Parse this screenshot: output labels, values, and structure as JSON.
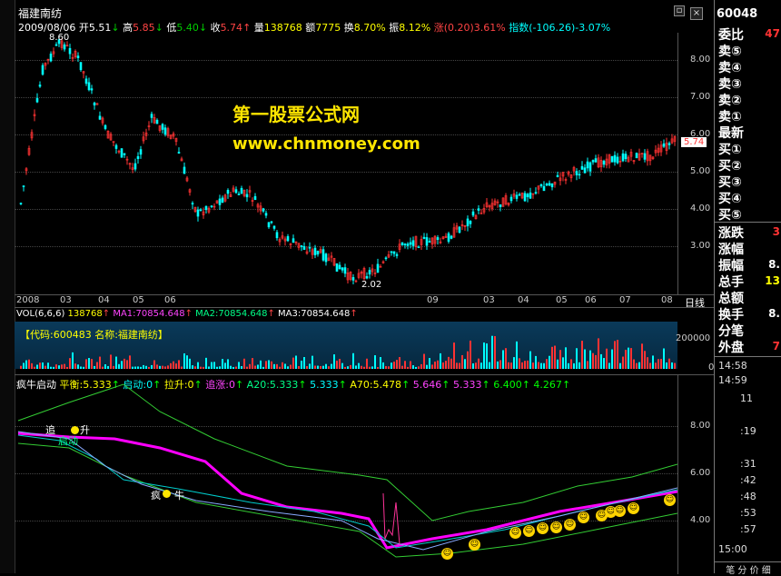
{
  "window": {
    "title": "福建南纺",
    "stock_code_partial": "60048"
  },
  "quote_line": {
    "date": "2009/08/06",
    "open_label": "开",
    "open": "5.51",
    "high_label": "高",
    "high": "5.85",
    "low_label": "低",
    "low": "5.40",
    "close_label": "收",
    "close": "5.74",
    "volume_label": "量",
    "volume": "138768",
    "amount_label": "额",
    "amount": "7775",
    "turnover_label": "换",
    "turnover": "8.70%",
    "amplitude_label": "振",
    "amplitude": "8.12%",
    "change_label": "涨",
    "change": "(0.20)3.61%",
    "index_label": "指数",
    "index": "(-106.26)-3.07%"
  },
  "price_chart": {
    "high_marker": "8.60",
    "low_marker": "2.02",
    "current_price": "5.74",
    "y_ticks": [
      "8.00",
      "7.00",
      "6.00",
      "5.00",
      "4.00",
      "3.00"
    ],
    "x_labels": [
      "2008",
      "03",
      "04",
      "05",
      "06",
      "09",
      "03",
      "04",
      "05",
      "06",
      "07",
      "08"
    ],
    "period_label": "日线"
  },
  "watermark": {
    "line1": "第一股票公式网",
    "line2": "www.chnmoney.com"
  },
  "volume_panel": {
    "params": "VOL(6,6,6)",
    "vol": "138768",
    "ma1": "MA1:70854.648",
    "ma2": "MA2:70854.648",
    "ma3": "MA3:70854.648",
    "info": "【代码:600483 名称:福建南纺】",
    "y_tick": "200000",
    "zero": "0"
  },
  "indicator_panel": {
    "name": "疯牛启动",
    "items": [
      {
        "text": "平衡:5.333",
        "color": "#ffff00"
      },
      {
        "text": "启动:0",
        "color": "#00ffff"
      },
      {
        "text": "拉升:0",
        "color": "#ffff00"
      },
      {
        "text": "追涨:0",
        "color": "#ff44ff"
      },
      {
        "text": "A20:5.333",
        "color": "#00ff88"
      },
      {
        "text": "5.333",
        "color": "#00ffff"
      },
      {
        "text": "A70:5.478",
        "color": "#ffff00"
      },
      {
        "text": "5.646",
        "color": "#ff44ff"
      },
      {
        "text": "5.333",
        "color": "#ff44ff"
      },
      {
        "text": "6.400",
        "color": "#00ff00"
      },
      {
        "text": "4.267",
        "color": "#00ff00"
      }
    ],
    "y_ticks": [
      "8.00",
      "6.00",
      "4.00"
    ],
    "labels": {
      "chase": "追",
      "rise": "升",
      "bull": "疯",
      "cow": "牛",
      "start": "启动"
    }
  },
  "right_panel": {
    "weibi_label": "委比",
    "weibi_value": "47",
    "sell": [
      "卖⑤",
      "卖④",
      "卖③",
      "卖②",
      "卖①"
    ],
    "latest": "最新",
    "buy": [
      "买①",
      "买②",
      "买③",
      "买④",
      "买⑤"
    ],
    "stats": [
      {
        "label": "涨跌",
        "value": "3"
      },
      {
        "label": "涨幅",
        "value": ""
      },
      {
        "label": "振幅",
        "value": "8."
      },
      {
        "label": "总手",
        "value": "13"
      },
      {
        "label": "总额",
        "value": ""
      },
      {
        "label": "换手",
        "value": "8."
      },
      {
        "label": "分笔",
        "value": ""
      },
      {
        "label": "外盘",
        "value": "7"
      }
    ],
    "times": [
      "14:58",
      "14:59",
      "",
      "",
      "",
      "",
      "",
      "",
      "",
      "",
      "",
      "15:00"
    ],
    "tick_vals": [
      "11",
      "",
      ":19",
      "",
      ":31",
      ":42",
      ":48",
      ":53",
      ":57",
      ""
    ],
    "bottom_tabs": "笔 分 价 细"
  }
}
